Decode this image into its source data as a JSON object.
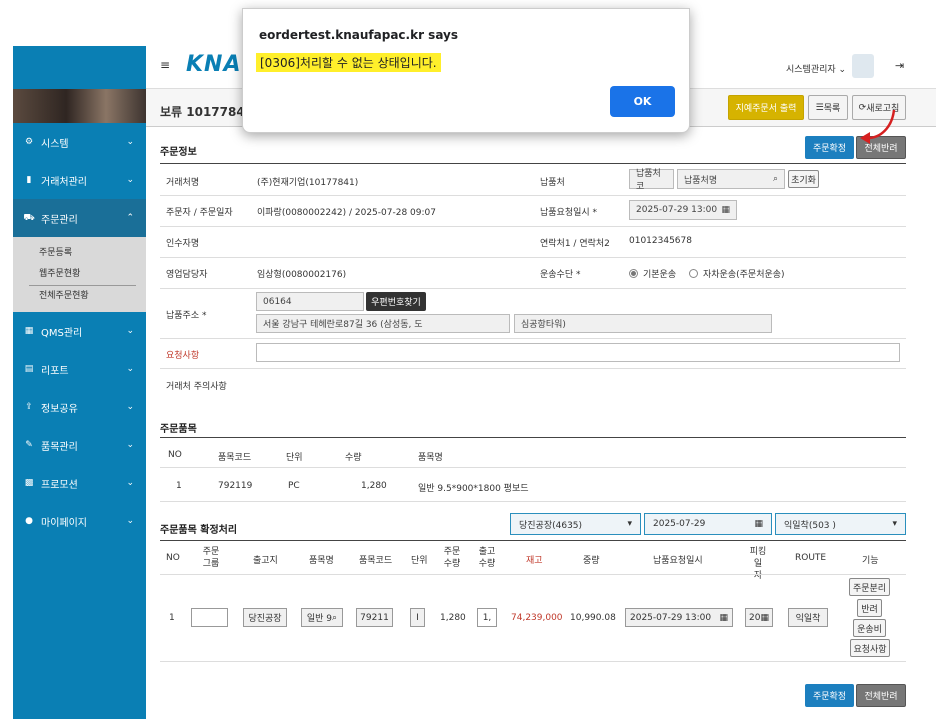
{
  "dialog": {
    "title": "eordertest.knaufapac.kr says",
    "message": "[0306]처리할 수 없는 상태입니다.",
    "ok_label": "OK"
  },
  "header": {
    "logo": "KNAUF",
    "admin": "시스템관리자 ⌄"
  },
  "sidebar": {
    "items": [
      {
        "label": "시스템"
      },
      {
        "label": "거래처관리"
      },
      {
        "label": "주문관리"
      },
      {
        "label": "QMS관리"
      },
      {
        "label": "리포트"
      },
      {
        "label": "정보공유"
      },
      {
        "label": "품목관리"
      },
      {
        "label": "프로모션"
      },
      {
        "label": "마이페이지"
      }
    ],
    "sub": [
      "주문등록",
      "웹주문현황",
      "전체주문현황"
    ]
  },
  "page": {
    "title": "보류 10177841",
    "btn_print": "지예주문서 출력",
    "btn_list": "목록",
    "btn_refresh": "새로고침"
  },
  "order_info": {
    "section": "주문정보",
    "btn_confirm": "주문확정",
    "btn_return_all": "전체반려",
    "customer_label": "거래처명",
    "customer": "(주)현재기업(10177841)",
    "dest_label": "납품처",
    "dest_ph1": "납품처코",
    "dest_ph2": "납품처명",
    "btn_reset": "초기화",
    "orderer_label": "주문자 / 주문일자",
    "orderer": "이파랑(0080002242) / 2025-07-28 09:07",
    "due_label": "납품요청일시 *",
    "due": "2025-07-29 13:00",
    "receiver_label": "인수자명",
    "contact_label": "연락처1 / 연락처2",
    "contact": "01012345678",
    "sales_label": "영업담당자",
    "sales": "임상형(0080002176)",
    "transport_label": "운송수단 *",
    "transport_opt1": "기본운송",
    "transport_opt2": "자차운송(주문처운송)",
    "addr_label": "납품주소 *",
    "zip": "06164",
    "btn_zip": "우편번호찾기",
    "addr1": "서울 강남구 테헤란로87길 36 (삼성동, 도",
    "addr2": "심공항타워)",
    "request_label": "요청사항",
    "caution_label": "거래처 주의사항"
  },
  "items": {
    "section": "주문품목",
    "headers": [
      "NO",
      "품목코드",
      "단위",
      "수량",
      "품목명"
    ],
    "rows": [
      {
        "no": "1",
        "code": "792119",
        "unit": "PC",
        "qty": "1,280",
        "name": "일반 9.5*900*1800 평보드"
      }
    ]
  },
  "confirm": {
    "section": "주문품목 확정처리",
    "plant": "당진공장(4635)",
    "date": "2025-07-29",
    "route": "익일착(503 )",
    "headers": [
      "NO",
      "주문\n그룹",
      "출고지",
      "품목명",
      "품목코드",
      "단위",
      "주문\n수량",
      "출고\n수량",
      "재고",
      "중량",
      "납품요청일시",
      "피킹일\n자",
      "ROUTE",
      "기능"
    ],
    "row": {
      "no": "1",
      "group": "",
      "plant": "당진공장",
      "name": "일반 9",
      "code": "79211",
      "unit": "I",
      "qty": "1,280",
      "out": "1,",
      "stock": "74,239,000",
      "weight": "10,990.08",
      "due": "2025-07-29 13:00",
      "pick": "20",
      "route": "익일착"
    },
    "funcs": [
      "주문분리",
      "반려",
      "운송비",
      "요청사항"
    ],
    "btn_confirm": "주문확정",
    "btn_return_all": "전체반려"
  },
  "colors": {
    "sidebar": "#0a7fb4",
    "primary": "#1c7fbf",
    "highlight": "#ffef2b"
  }
}
